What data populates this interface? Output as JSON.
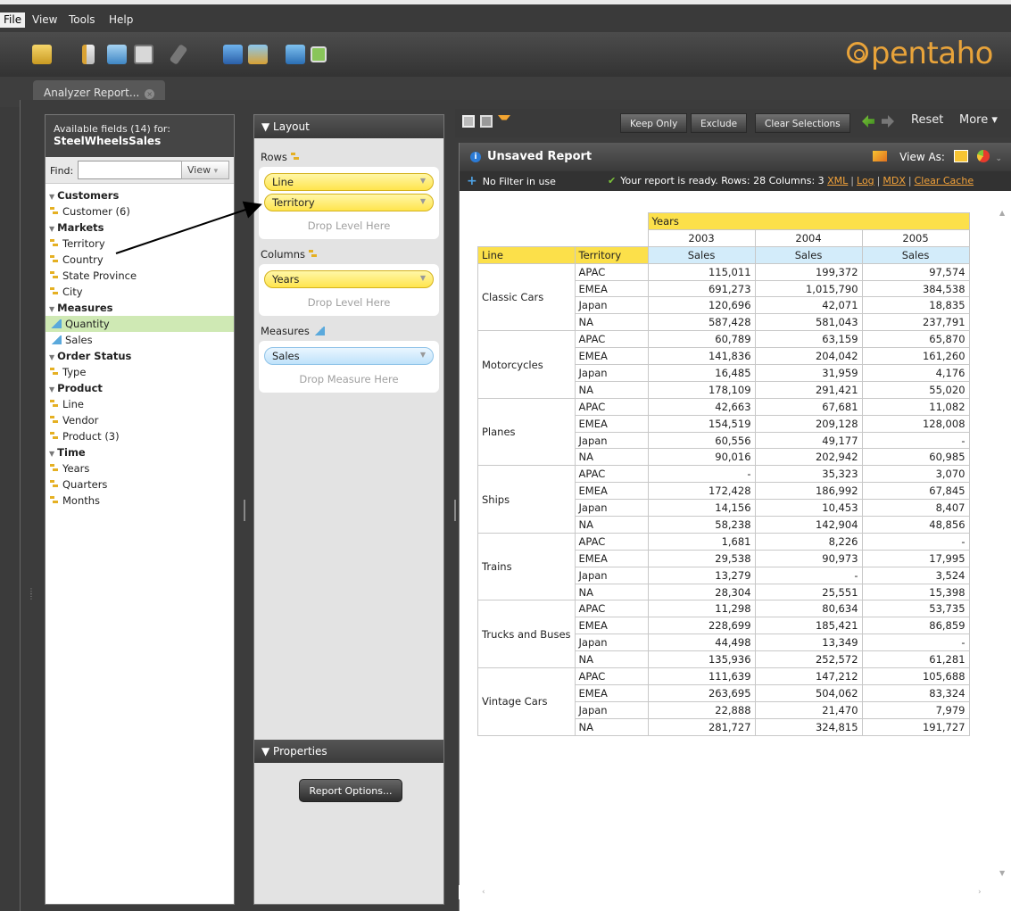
{
  "menu": [
    "File",
    "View",
    "Tools",
    "Help"
  ],
  "brand": "pentaho",
  "tab": {
    "label": "Analyzer Report...",
    "close": "×"
  },
  "fields_panel": {
    "header": "Available fields (14) for:",
    "model": "SteelWheelsSales",
    "find_label": "Find:",
    "find_value": "",
    "view_button": "View",
    "tree": [
      {
        "kind": "category",
        "label": "Customers"
      },
      {
        "kind": "level",
        "label": "Customer (6)"
      },
      {
        "kind": "category",
        "label": "Markets"
      },
      {
        "kind": "level",
        "label": "Territory"
      },
      {
        "kind": "level",
        "label": "Country"
      },
      {
        "kind": "level",
        "label": "State Province"
      },
      {
        "kind": "level",
        "label": "City"
      },
      {
        "kind": "category",
        "label": "Measures"
      },
      {
        "kind": "measure",
        "label": "Quantity",
        "selected": true
      },
      {
        "kind": "measure",
        "label": "Sales"
      },
      {
        "kind": "category",
        "label": "Order Status"
      },
      {
        "kind": "level",
        "label": "Type"
      },
      {
        "kind": "category",
        "label": "Product"
      },
      {
        "kind": "level",
        "label": "Line"
      },
      {
        "kind": "level",
        "label": "Vendor"
      },
      {
        "kind": "level",
        "label": "Product (3)"
      },
      {
        "kind": "category",
        "label": "Time"
      },
      {
        "kind": "level",
        "label": "Years"
      },
      {
        "kind": "level",
        "label": "Quarters"
      },
      {
        "kind": "level",
        "label": "Months"
      }
    ]
  },
  "layout_panel": {
    "title": "▼ Layout",
    "rows_label": "Rows",
    "rows": [
      "Line",
      "Territory"
    ],
    "rows_drop": "Drop Level Here",
    "columns_label": "Columns",
    "columns": [
      "Years"
    ],
    "columns_drop": "Drop Level Here",
    "measures_label": "Measures",
    "measures": [
      "Sales"
    ],
    "measures_drop": "Drop Measure Here",
    "properties_title": "▼ Properties",
    "report_options": "Report Options..."
  },
  "report_toolbar": {
    "keep_only": "Keep Only",
    "exclude": "Exclude",
    "clear_selections": "Clear Selections",
    "reset": "Reset",
    "more": "More ▾"
  },
  "report": {
    "title": "Unsaved Report",
    "view_as": "View As:",
    "filter_status": "No Filter in use",
    "ready_text": "Your report is ready.  Rows: 28  Columns: 3",
    "links": [
      "XML",
      "Log",
      "MDX",
      "Clear Cache"
    ]
  },
  "table": {
    "col_group": "Years",
    "years": [
      "2003",
      "2004",
      "2005"
    ],
    "row_headers": [
      "Line",
      "Territory"
    ],
    "measure": "Sales",
    "groups": [
      {
        "line": "Classic Cars",
        "rows": [
          {
            "territory": "APAC",
            "values": [
              "115,011",
              "199,372",
              "97,574"
            ]
          },
          {
            "territory": "EMEA",
            "values": [
              "691,273",
              "1,015,790",
              "384,538"
            ]
          },
          {
            "territory": "Japan",
            "values": [
              "120,696",
              "42,071",
              "18,835"
            ]
          },
          {
            "territory": "NA",
            "values": [
              "587,428",
              "581,043",
              "237,791"
            ]
          }
        ]
      },
      {
        "line": "Motorcycles",
        "rows": [
          {
            "territory": "APAC",
            "values": [
              "60,789",
              "63,159",
              "65,870"
            ]
          },
          {
            "territory": "EMEA",
            "values": [
              "141,836",
              "204,042",
              "161,260"
            ]
          },
          {
            "territory": "Japan",
            "values": [
              "16,485",
              "31,959",
              "4,176"
            ]
          },
          {
            "territory": "NA",
            "values": [
              "178,109",
              "291,421",
              "55,020"
            ]
          }
        ]
      },
      {
        "line": "Planes",
        "rows": [
          {
            "territory": "APAC",
            "values": [
              "42,663",
              "67,681",
              "11,082"
            ]
          },
          {
            "territory": "EMEA",
            "values": [
              "154,519",
              "209,128",
              "128,008"
            ]
          },
          {
            "territory": "Japan",
            "values": [
              "60,556",
              "49,177",
              "-"
            ]
          },
          {
            "territory": "NA",
            "values": [
              "90,016",
              "202,942",
              "60,985"
            ]
          }
        ]
      },
      {
        "line": "Ships",
        "rows": [
          {
            "territory": "APAC",
            "values": [
              "-",
              "35,323",
              "3,070"
            ]
          },
          {
            "territory": "EMEA",
            "values": [
              "172,428",
              "186,992",
              "67,845"
            ]
          },
          {
            "territory": "Japan",
            "values": [
              "14,156",
              "10,453",
              "8,407"
            ]
          },
          {
            "territory": "NA",
            "values": [
              "58,238",
              "142,904",
              "48,856"
            ]
          }
        ]
      },
      {
        "line": "Trains",
        "rows": [
          {
            "territory": "APAC",
            "values": [
              "1,681",
              "8,226",
              "-"
            ]
          },
          {
            "territory": "EMEA",
            "values": [
              "29,538",
              "90,973",
              "17,995"
            ]
          },
          {
            "territory": "Japan",
            "values": [
              "13,279",
              "-",
              "3,524"
            ]
          },
          {
            "territory": "NA",
            "values": [
              "28,304",
              "25,551",
              "15,398"
            ]
          }
        ]
      },
      {
        "line": "Trucks and Buses",
        "rows": [
          {
            "territory": "APAC",
            "values": [
              "11,298",
              "80,634",
              "53,735"
            ]
          },
          {
            "territory": "EMEA",
            "values": [
              "228,699",
              "185,421",
              "86,859"
            ]
          },
          {
            "territory": "Japan",
            "values": [
              "44,498",
              "13,349",
              "-"
            ]
          },
          {
            "territory": "NA",
            "values": [
              "135,936",
              "252,572",
              "61,281"
            ]
          }
        ]
      },
      {
        "line": "Vintage Cars",
        "rows": [
          {
            "territory": "APAC",
            "values": [
              "111,639",
              "147,212",
              "105,688"
            ]
          },
          {
            "territory": "EMEA",
            "values": [
              "263,695",
              "504,062",
              "83,324"
            ]
          },
          {
            "territory": "Japan",
            "values": [
              "22,888",
              "21,470",
              "7,979"
            ]
          },
          {
            "territory": "NA",
            "values": [
              "281,727",
              "324,815",
              "191,727"
            ]
          }
        ]
      }
    ]
  }
}
